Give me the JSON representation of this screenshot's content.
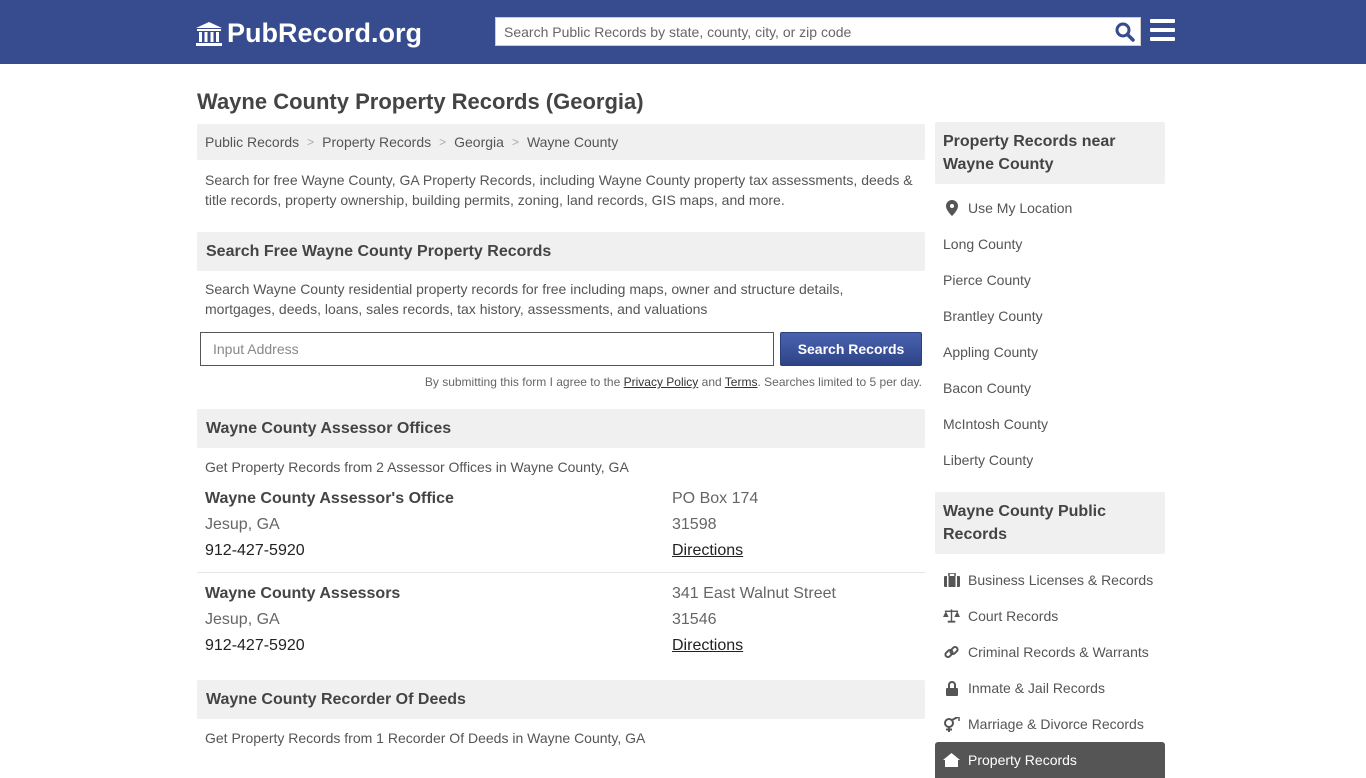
{
  "header": {
    "logo_text": "PubRecord.org",
    "search_placeholder": "Search Public Records by state, county, city, or zip code"
  },
  "page": {
    "title": "Wayne County Property Records (Georgia)",
    "breadcrumbs": [
      "Public Records",
      "Property Records",
      "Georgia",
      "Wayne County"
    ],
    "intro": "Search for free Wayne County, GA Property Records, including Wayne County property tax assessments, deeds & title records, property ownership, building permits, zoning, land records, GIS maps, and more."
  },
  "search_section": {
    "heading": "Search Free Wayne County Property Records",
    "description": "Search Wayne County residential property records for free including maps, owner and structure details, mortgages, deeds, loans, sales records, tax history, assessments, and valuations",
    "input_placeholder": "Input Address",
    "button_label": "Search Records",
    "disclaimer_prefix": "By submitting this form I agree to the ",
    "privacy_link": "Privacy Policy",
    "and": " and ",
    "terms_link": "Terms",
    "disclaimer_suffix": ". Searches limited to 5 per day."
  },
  "assessors": {
    "heading": "Wayne County Assessor Offices",
    "description": "Get Property Records from 2 Assessor Offices in Wayne County, GA",
    "offices": [
      {
        "name": "Wayne County Assessor's Office",
        "city": "Jesup, GA",
        "phone": "912-427-5920",
        "address": "PO Box 174",
        "zip": "31598",
        "directions": "Directions"
      },
      {
        "name": "Wayne County Assessors",
        "city": "Jesup, GA",
        "phone": "912-427-5920",
        "address": "341 East Walnut Street",
        "zip": "31546",
        "directions": "Directions"
      }
    ]
  },
  "recorders": {
    "heading": "Wayne County Recorder Of Deeds",
    "description": "Get Property Records from 1 Recorder Of Deeds in Wayne County, GA"
  },
  "sidebar": {
    "nearby_heading": "Property Records near Wayne County",
    "use_location": "Use My Location",
    "nearby": [
      "Long County",
      "Pierce County",
      "Brantley County",
      "Appling County",
      "Bacon County",
      "McIntosh County",
      "Liberty County"
    ],
    "public_heading": "Wayne County Public Records",
    "public_records": [
      {
        "label": "Business Licenses & Records",
        "icon": "briefcase-icon"
      },
      {
        "label": "Court Records",
        "icon": "scales-icon"
      },
      {
        "label": "Criminal Records & Warrants",
        "icon": "link-icon"
      },
      {
        "label": "Inmate & Jail Records",
        "icon": "lock-icon"
      },
      {
        "label": "Marriage & Divorce Records",
        "icon": "gender-icon"
      },
      {
        "label": "Property Records",
        "icon": "home-icon",
        "active": true
      }
    ]
  }
}
